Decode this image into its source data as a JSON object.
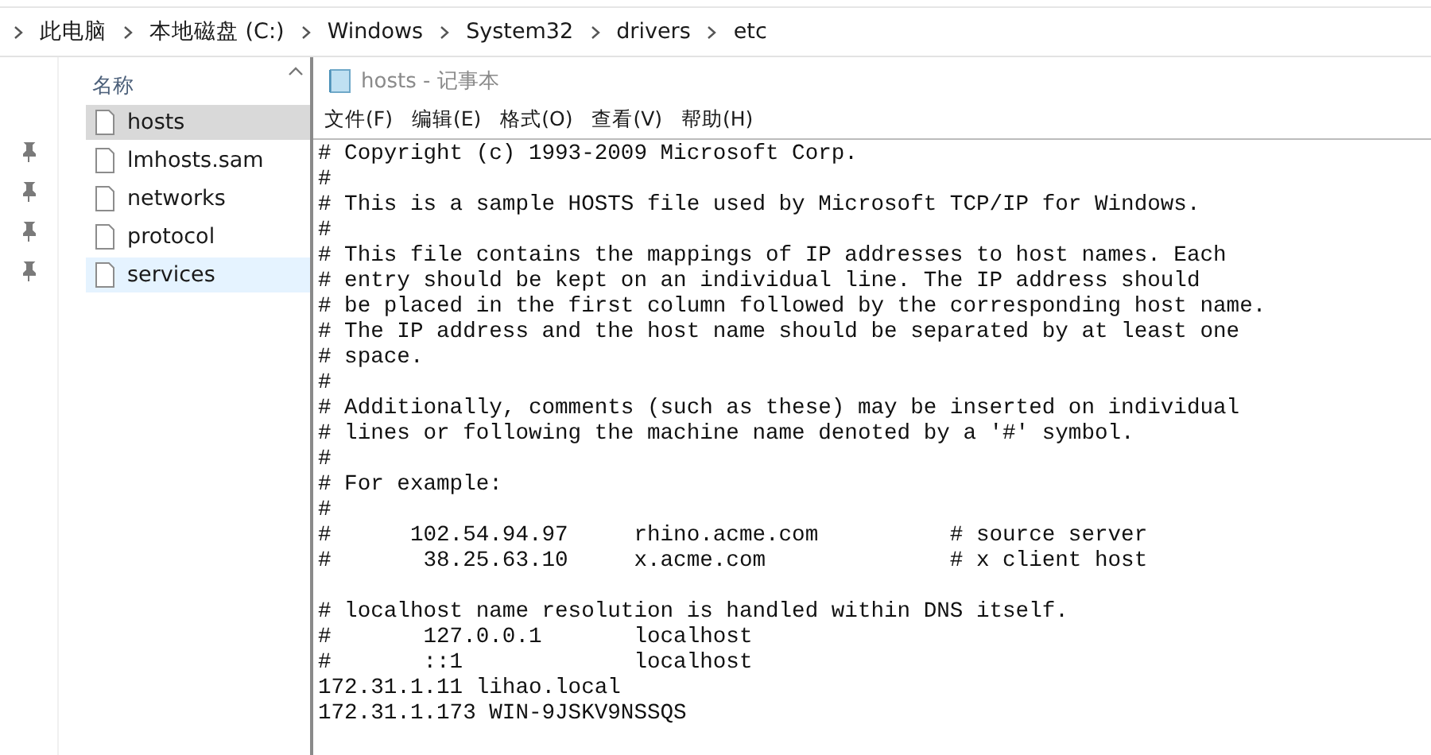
{
  "breadcrumb": [
    "此电脑",
    "本地磁盘 (C:)",
    "Windows",
    "System32",
    "drivers",
    "etc"
  ],
  "file_list": {
    "column_header": "名称",
    "files": [
      {
        "name": "hosts",
        "selected": true,
        "hovered": false
      },
      {
        "name": "lmhosts.sam",
        "selected": false,
        "hovered": false
      },
      {
        "name": "networks",
        "selected": false,
        "hovered": false
      },
      {
        "name": "protocol",
        "selected": false,
        "hovered": false
      },
      {
        "name": "services",
        "selected": false,
        "hovered": true
      }
    ]
  },
  "notepad": {
    "title": "hosts - 记事本",
    "menu": [
      "文件(F)",
      "编辑(E)",
      "格式(O)",
      "查看(V)",
      "帮助(H)"
    ],
    "blocks": [
      [
        "# Copyright (c) 1993-2009 Microsoft Corp.",
        "#",
        "# This is a sample HOSTS file used by Microsoft TCP/IP for Windows.",
        "#",
        "# This file contains the mappings of IP addresses to host names. Each",
        "# entry should be kept on an individual line. The IP address should",
        "# be placed in the first column followed by the corresponding host name.",
        "# The IP address and the host name should be separated by at least one",
        "# space.",
        "#",
        "# Additionally, comments (such as these) may be inserted on individual",
        "# lines or following the machine name denoted by a '#' symbol.",
        "#",
        "# For example:",
        "#",
        "#      102.54.94.97     rhino.acme.com          # source server",
        "#       38.25.63.10     x.acme.com              # x client host"
      ],
      [
        "# localhost name resolution is handled within DNS itself.",
        "#       127.0.0.1       localhost",
        "#       ::1             localhost",
        "172.31.1.11 lihao.local",
        "172.31.1.173 WIN-9JSKV9NSSQS"
      ]
    ]
  }
}
